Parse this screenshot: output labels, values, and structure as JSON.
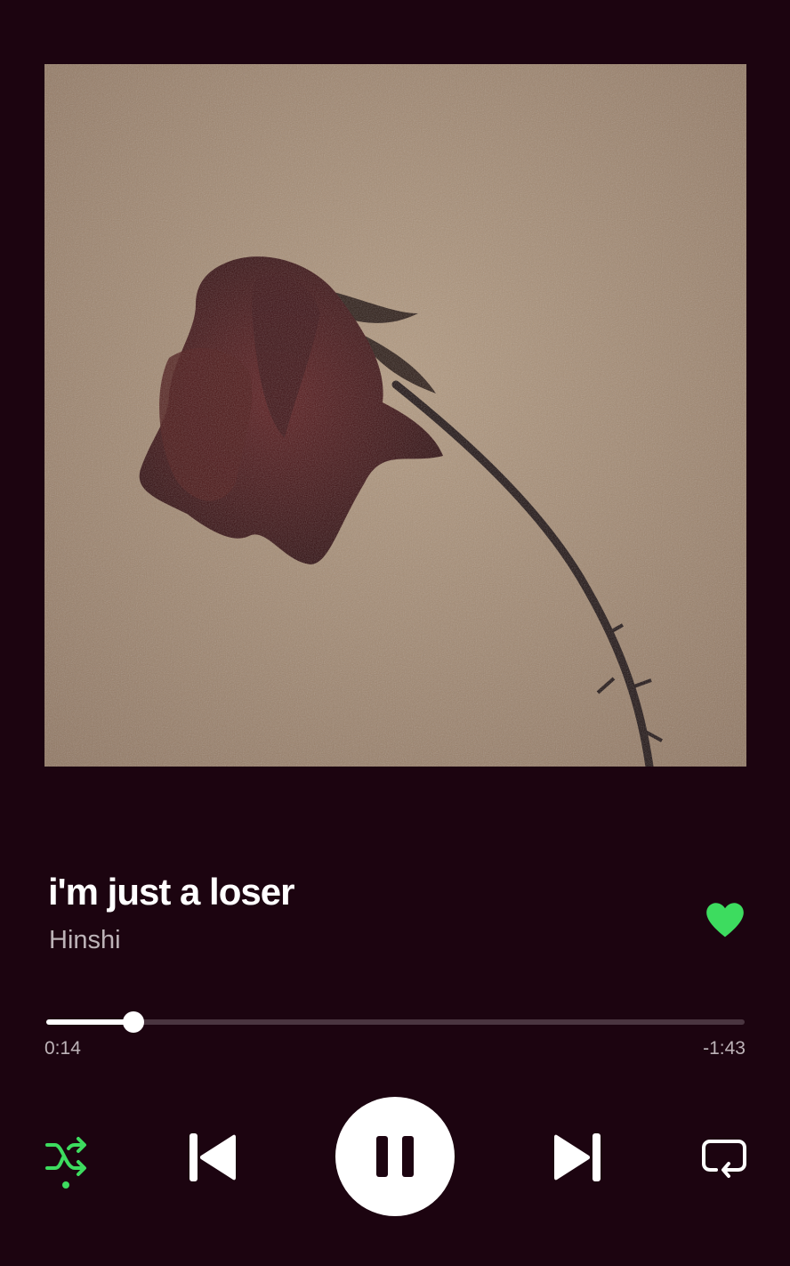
{
  "track": {
    "title": "i'm just a loser",
    "artist": "Hinshi",
    "liked": true
  },
  "playback": {
    "elapsed": "0:14",
    "remaining": "-1:43",
    "progress_fraction": 0.125,
    "is_playing": true,
    "shuffle_on": true,
    "repeat_on": false
  },
  "icons": {
    "like": "heart-icon",
    "shuffle": "shuffle-icon",
    "previous": "skip-previous-icon",
    "play_pause": "pause-icon",
    "next": "skip-next-icon",
    "repeat": "repeat-icon"
  },
  "colors": {
    "background": "#1c0410",
    "accent": "#3ddc5f",
    "text_primary": "#ffffff",
    "text_secondary": "#bdb3b8",
    "track_bg": "#4a3540"
  }
}
